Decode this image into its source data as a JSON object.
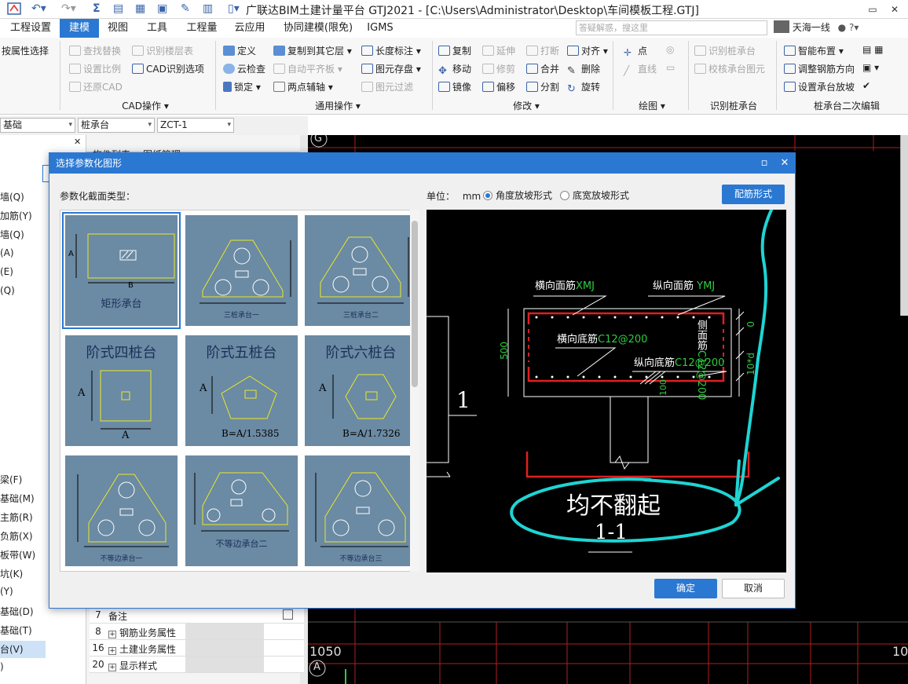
{
  "window": {
    "title": "广联达BIM土建计量平台 GTJ2021 - [C:\\Users\\Administrator\\Desktop\\车间模板工程.GTJ]",
    "controls": [
      "▭",
      "✕"
    ]
  },
  "menu": {
    "items": [
      "工程设置",
      "建模",
      "视图",
      "工具",
      "工程量",
      "云应用",
      "协同建模(限免)",
      "IGMS"
    ],
    "active_index": 1,
    "search_placeholder": "答疑解惑，搜这里",
    "user": "天海一线"
  },
  "ribbon": {
    "left_item": "按属性选择",
    "cad_ops": {
      "items": [
        "查找替换",
        "识别楼层表",
        "设置比例",
        "CAD识别选项",
        "还原CAD"
      ],
      "label": "CAD操作"
    },
    "common_ops": {
      "items": [
        "定义",
        "复制到其它层",
        "长度标注",
        "云检查",
        "自动平齐板",
        "图元存盘",
        "锁定",
        "两点辅轴",
        "图元过滤"
      ],
      "label": "通用操作"
    },
    "modify": {
      "items": [
        "复制",
        "延伸",
        "打断",
        "对齐",
        "移动",
        "修剪",
        "合并",
        "删除",
        "镜像",
        "偏移",
        "分割",
        "旋转"
      ],
      "label": "修改"
    },
    "draw": {
      "items": [
        "点",
        "直线"
      ],
      "label": "绘图"
    },
    "identify": {
      "items": [
        "识别桩承台",
        "校核承台图元"
      ],
      "label": "识别桩承台"
    },
    "secondary": {
      "items": [
        "智能布置",
        "调整钢筋方向",
        "设置承台放坡"
      ],
      "label": "桩承台二次编辑"
    }
  },
  "combos": [
    "基础",
    "桩承台",
    "ZCT-1"
  ],
  "left_panel": {
    "items_top": [
      "墙(Q)",
      "加筋(Y)",
      "墙(Q)",
      "(A)",
      "(E)",
      "(Q)"
    ],
    "items_bottom": [
      "梁(F)",
      "基础(M)",
      "主筋(R)",
      "负筋(X)",
      "板带(W)",
      "坑(K)",
      "(Y)",
      "基础(D)",
      "基础(T)",
      "台(V)",
      ")"
    ],
    "selected_bottom_index": 9
  },
  "properties": {
    "tabs": [
      "构件列表",
      "图纸管理"
    ],
    "rows": [
      {
        "num": "7",
        "name": "备注",
        "expandable": false
      },
      {
        "num": "8",
        "name": "钢筋业务属性",
        "expandable": true
      },
      {
        "num": "16",
        "name": "土建业务属性",
        "expandable": true
      },
      {
        "num": "20",
        "name": "显示样式",
        "expandable": true
      }
    ]
  },
  "cad": {
    "axis_top": "G",
    "axis_bottom": "A",
    "dim_left": "1050",
    "dim_right": "10"
  },
  "dialog": {
    "title": "选择参数化图形",
    "section_label": "参数化截面类型：",
    "unit_label": "单位：",
    "unit_value": "mm",
    "radio_angle": "角度放坡形式",
    "radio_width": "底宽放坡形式",
    "rebar_button": "配筋形式",
    "ok_button": "确定",
    "cancel_button": "取消",
    "thumbnails": [
      {
        "caption": "矩形承台",
        "dims": [
          "A",
          "B"
        ]
      },
      {
        "caption": "三桩承台一"
      },
      {
        "caption": "三桩承台二"
      },
      {
        "caption": "阶式四桩台",
        "dims": [
          "A",
          "A"
        ]
      },
      {
        "caption": "阶式五桩台",
        "formula": "B=A/1.5385",
        "dims": [
          "A"
        ]
      },
      {
        "caption": "阶式六桩台",
        "formula": "B=A/1.7326",
        "dims": [
          "A"
        ]
      },
      {
        "caption": "不等边承台一"
      },
      {
        "caption": "不等边承台二"
      },
      {
        "caption": "不等边承台三"
      }
    ],
    "preview": {
      "top_transverse": "横向面筋",
      "top_transverse_code": "XMJ",
      "top_longitudinal": "纵向面筋",
      "top_longitudinal_code": "YMJ",
      "bottom_transverse": "横向底筋",
      "bottom_transverse_code": "C12@200",
      "bottom_longitudinal": "纵向底筋",
      "bottom_longitudinal_code": "C12@200",
      "side": "侧面筋",
      "side_code": "C12@200",
      "height": "500",
      "zero": "0",
      "hook": "10*d",
      "cover": "100",
      "section_mark": "1",
      "handwritten_note": "均不翻起",
      "section_title": "1-1"
    }
  }
}
